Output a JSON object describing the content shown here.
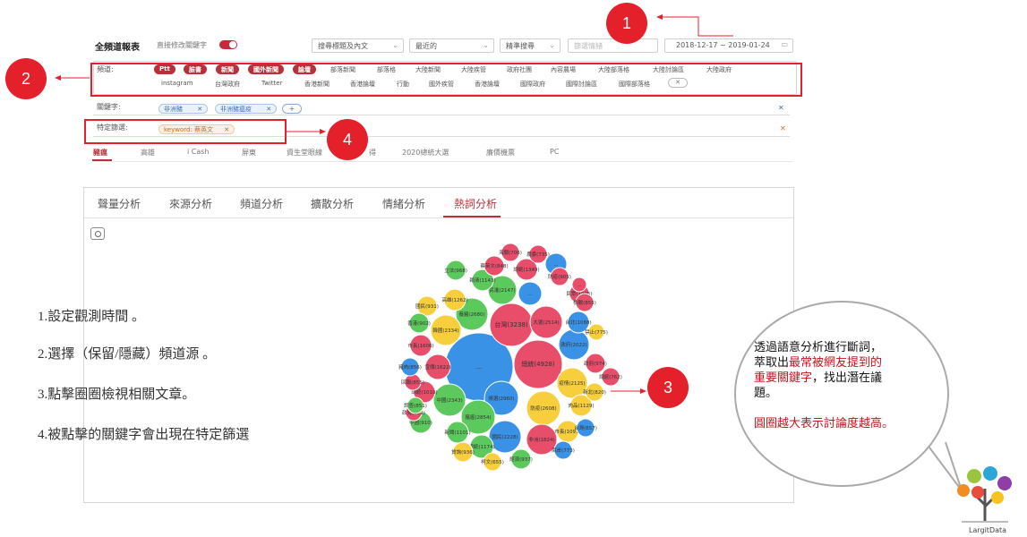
{
  "toolbar": {
    "title": "全頻道報表",
    "toggle_label": "直接修改關鍵字",
    "search_scope": "搜尋標題及內文",
    "sort": "最近的",
    "search_mode": "精準搜尋",
    "input_placeholder": "篩選情緒",
    "date_range": "2018-12-17  ~  2019-01-24"
  },
  "channels": {
    "label": "頻道:",
    "active": [
      "Ptt",
      "臉書",
      "新聞",
      "國外新聞",
      "論壇"
    ],
    "row1": [
      "部落新聞",
      "部落格",
      "大陸新聞",
      "大陸疾管",
      "政府社團",
      "內容農場",
      "大陸部落格",
      "大陸討論區",
      "大陸政府"
    ],
    "row2": [
      "instagram",
      "台灣政府",
      "Twitter",
      "香港新聞",
      "香港論壇",
      "行動",
      "國外疾管",
      "香港論壇",
      "國際政府",
      "國際討論區",
      "國際部落格"
    ],
    "close": "✕"
  },
  "keywords": {
    "label": "關鍵字:",
    "tags": [
      "非洲豬",
      "非洲豬瘟疫"
    ],
    "add": "+"
  },
  "filter": {
    "label": "特定篩選:",
    "tag": "keyword: 蔡英文"
  },
  "sub_tabs": [
    "豬瘟",
    "高雄",
    "i Cash",
    "屏東",
    "資生堂眼線",
    "得",
    "2020總統大選",
    "廉價機票",
    "PC"
  ],
  "analysis_tabs": [
    "聲量分析",
    "來源分析",
    "頻道分析",
    "擴散分析",
    "情緒分析",
    "熱詞分析"
  ],
  "steps": [
    "1.設定觀測時間 。",
    "2.選擇（保留/隱藏）頻道源 。",
    "3.點擊圈圈檢視相關文章。",
    "4.被點擊的關鍵字會出現在特定篩選"
  ],
  "badges": [
    "1",
    "2",
    "3",
    "4"
  ],
  "bubble": {
    "line1": "透過語意分析進行斷詞，",
    "line2_a": "萃取出",
    "line2_b": "最常被網友提到的",
    "line3_a": "重要關鍵字",
    "line3_b": "，找出潛在議",
    "line4": "題。",
    "line5": "圓圈越大表示討論度越高。"
  },
  "logo": "LargitData",
  "colors": {
    "red": "#e84d6a",
    "blue": "#3a92e6",
    "green": "#5cc95c",
    "yellow": "#f7cf3c",
    "accent": "#b7303a",
    "annotation": "#e4212b"
  },
  "bubbles": [
    {
      "label": "...",
      "color": "blue"
    },
    {
      "label": "總統(4928)",
      "color": "red"
    },
    {
      "label": "台灣(3238)",
      "color": "red"
    },
    {
      "label": "大選(2514)",
      "color": "red"
    },
    {
      "label": "候選(2960)",
      "color": "blue"
    },
    {
      "label": "豬瘟(2854)",
      "color": "green"
    },
    {
      "label": "防疫(2608)",
      "color": "yellow"
    },
    {
      "label": "養豬(2680)",
      "color": "green"
    },
    {
      "label": "民進(2147)",
      "color": "green"
    },
    {
      "label": "...",
      "color": "blue"
    },
    {
      "label": "韓國(2334)",
      "color": "yellow"
    },
    {
      "label": "中國(2343)",
      "color": "green"
    },
    {
      "label": "國民(2228)",
      "color": "blue"
    },
    {
      "label": "疫情(2125)",
      "color": "yellow"
    },
    {
      "label": "政府(2022)",
      "color": "blue"
    },
    {
      "label": "非洲(1824)",
      "color": "red"
    },
    {
      "label": "宣傳(1622)",
      "color": "red"
    },
    {
      "label": "市長(1606)",
      "color": "red"
    },
    {
      "label": "總統(1349)",
      "color": "red"
    },
    {
      "label": "高雄(1262)",
      "color": "yellow"
    },
    {
      "label": "賴清(1143)",
      "color": "green"
    },
    {
      "label": "...",
      "color": "blue"
    },
    {
      "label": "新聞(1101)",
      "color": "green"
    },
    {
      "label": "總統(1174)",
      "color": "green"
    },
    {
      "label": "民眾(1095)",
      "color": "red"
    },
    {
      "label": "肉品(1129)",
      "color": "yellow"
    },
    {
      "label": "台北(1088)",
      "color": "blue"
    },
    {
      "label": "總統(1010)",
      "color": "red"
    },
    {
      "label": "市長(1097)",
      "color": "yellow"
    },
    {
      "label": "立法(968)",
      "color": "green"
    },
    {
      "label": "蔡英文(848)",
      "color": "red"
    },
    {
      "label": "國民(931)",
      "color": "yellow"
    },
    {
      "label": "經濟(937)",
      "color": "green"
    },
    {
      "label": "質詢(936)",
      "color": "yellow"
    },
    {
      "label": "政府(974)",
      "color": "red"
    },
    {
      "label": "香港(902)",
      "color": "green"
    },
    {
      "label": "中國(910)",
      "color": "green"
    },
    {
      "label": "檢驗(855)",
      "color": "red"
    },
    {
      "label": "台灣(857)",
      "color": "blue"
    },
    {
      "label": "新北(820)",
      "color": "yellow"
    },
    {
      "label": "防疫(905)",
      "color": "red"
    },
    {
      "label": "回報(855)",
      "color": "red"
    },
    {
      "label": "政見(822)",
      "color": "red"
    },
    {
      "label": "禁止(775)",
      "color": "yellow"
    },
    {
      "label": "兩岸(773)",
      "color": "blue"
    },
    {
      "label": "總統(762)",
      "color": "red"
    },
    {
      "label": "農委(735)",
      "color": "red"
    },
    {
      "label": "海關(706)",
      "color": "red"
    },
    {
      "label": "豬肉(856)",
      "color": "blue"
    },
    {
      "label": "柯文(655)",
      "color": "yellow"
    },
    {
      "label": "調查(851)",
      "color": "green"
    },
    {
      "label": "...",
      "color": "red"
    }
  ]
}
